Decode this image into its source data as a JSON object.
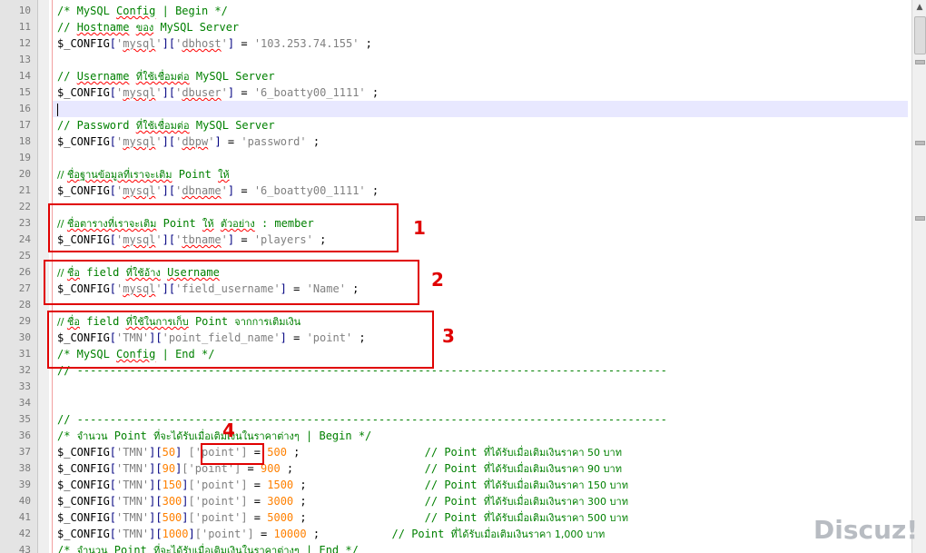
{
  "editor": {
    "lines": [
      {
        "n": "10",
        "parts": [
          [
            "cmt",
            "/* MySQL "
          ],
          [
            "cmt squig",
            "Config"
          ],
          [
            "cmt",
            " | Begin */"
          ]
        ]
      },
      {
        "n": "11",
        "parts": [
          [
            "cmt",
            "// "
          ],
          [
            "cmt squig",
            "Hostname"
          ],
          [
            "cmt",
            " "
          ],
          [
            "cmt thai squig",
            "ของ"
          ],
          [
            "cmt",
            " MySQL Server"
          ]
        ]
      },
      {
        "n": "12",
        "parts": [
          [
            "",
            "$_CONFIG"
          ],
          [
            "op",
            "["
          ],
          [
            "str",
            "'"
          ],
          [
            "str squig",
            "mysql"
          ],
          [
            "str",
            "'"
          ],
          [
            "op",
            "]["
          ],
          [
            "str",
            "'"
          ],
          [
            "str squig",
            "dbhost"
          ],
          [
            "str",
            "'"
          ],
          [
            "op",
            "]"
          ],
          [
            "",
            " = "
          ],
          [
            "str",
            "'103.253.74.155'"
          ],
          [
            "",
            " ;"
          ]
        ]
      },
      {
        "n": "13",
        "parts": []
      },
      {
        "n": "14",
        "parts": [
          [
            "cmt",
            "// "
          ],
          [
            "cmt squig",
            "Username"
          ],
          [
            "cmt",
            " "
          ],
          [
            "cmt thai squig",
            "ที่ใช้เชื่อมต่อ"
          ],
          [
            "cmt",
            " MySQL Server"
          ]
        ]
      },
      {
        "n": "15",
        "parts": [
          [
            "",
            "$_CONFIG"
          ],
          [
            "op",
            "["
          ],
          [
            "str",
            "'"
          ],
          [
            "str squig",
            "mysql"
          ],
          [
            "str",
            "'"
          ],
          [
            "op",
            "]["
          ],
          [
            "str",
            "'"
          ],
          [
            "str squig",
            "dbuser"
          ],
          [
            "str",
            "'"
          ],
          [
            "op",
            "]"
          ],
          [
            "",
            " = "
          ],
          [
            "str",
            "'6_boatty00_1111'"
          ],
          [
            "",
            " ;"
          ]
        ]
      },
      {
        "n": "16",
        "parts": [
          [
            "cursor",
            ""
          ]
        ],
        "current": true
      },
      {
        "n": "17",
        "parts": [
          [
            "cmt",
            "// Password "
          ],
          [
            "cmt thai squig",
            "ที่ใช้เชื่อมต่อ"
          ],
          [
            "cmt",
            " MySQL Server"
          ]
        ]
      },
      {
        "n": "18",
        "parts": [
          [
            "",
            "$_CONFIG"
          ],
          [
            "op",
            "["
          ],
          [
            "str",
            "'"
          ],
          [
            "str squig",
            "mysql"
          ],
          [
            "str",
            "'"
          ],
          [
            "op",
            "]["
          ],
          [
            "str",
            "'"
          ],
          [
            "str squig",
            "dbpw"
          ],
          [
            "str",
            "'"
          ],
          [
            "op",
            "]"
          ],
          [
            "",
            " = "
          ],
          [
            "str",
            "'password'"
          ],
          [
            "",
            " ;"
          ]
        ]
      },
      {
        "n": "19",
        "parts": []
      },
      {
        "n": "20",
        "parts": [
          [
            "cmt thai",
            "// "
          ],
          [
            "cmt thai squig",
            "ชื่อฐานข้อมูลที่เราจะเติม"
          ],
          [
            "cmt",
            " Point "
          ],
          [
            "cmt thai squig",
            "ให้"
          ]
        ]
      },
      {
        "n": "21",
        "parts": [
          [
            "",
            "$_CONFIG"
          ],
          [
            "op",
            "["
          ],
          [
            "str",
            "'"
          ],
          [
            "str squig",
            "mysql"
          ],
          [
            "str",
            "'"
          ],
          [
            "op",
            "]["
          ],
          [
            "str",
            "'"
          ],
          [
            "str squig",
            "dbname"
          ],
          [
            "str",
            "'"
          ],
          [
            "op",
            "]"
          ],
          [
            "",
            " = "
          ],
          [
            "str",
            "'6_boatty00_1111'"
          ],
          [
            "",
            " ;"
          ]
        ]
      },
      {
        "n": "22",
        "parts": []
      },
      {
        "n": "23",
        "parts": [
          [
            "cmt thai",
            "// "
          ],
          [
            "cmt thai squig",
            "ชื่อตารางที่เราจะเติม"
          ],
          [
            "cmt",
            " Point "
          ],
          [
            "cmt thai squig",
            "ให้"
          ],
          [
            "cmt",
            " "
          ],
          [
            "cmt thai squig",
            "ตัวอย่าง"
          ],
          [
            "cmt",
            " : member"
          ]
        ]
      },
      {
        "n": "24",
        "parts": [
          [
            "",
            "$_CONFIG"
          ],
          [
            "op",
            "["
          ],
          [
            "str",
            "'"
          ],
          [
            "str squig",
            "mysql"
          ],
          [
            "str",
            "'"
          ],
          [
            "op",
            "]["
          ],
          [
            "str",
            "'"
          ],
          [
            "str squig",
            "tbname"
          ],
          [
            "str",
            "'"
          ],
          [
            "op",
            "]"
          ],
          [
            "",
            " = "
          ],
          [
            "str",
            "'players'"
          ],
          [
            "",
            " ;"
          ]
        ]
      },
      {
        "n": "25",
        "parts": []
      },
      {
        "n": "26",
        "parts": [
          [
            "cmt thai",
            "// "
          ],
          [
            "cmt thai squig",
            "ชื่อ"
          ],
          [
            "cmt",
            " field "
          ],
          [
            "cmt thai squig",
            "ที่ใช้อ้าง"
          ],
          [
            "cmt",
            " "
          ],
          [
            "cmt squig",
            "Username"
          ]
        ]
      },
      {
        "n": "27",
        "parts": [
          [
            "",
            "$_CONFIG"
          ],
          [
            "op",
            "["
          ],
          [
            "str",
            "'"
          ],
          [
            "str squig",
            "mysql"
          ],
          [
            "str",
            "'"
          ],
          [
            "op",
            "]["
          ],
          [
            "str",
            "'field_username'"
          ],
          [
            "op",
            "]"
          ],
          [
            "",
            " = "
          ],
          [
            "str",
            "'Name'"
          ],
          [
            "",
            " ;"
          ]
        ]
      },
      {
        "n": "28",
        "parts": []
      },
      {
        "n": "29",
        "parts": [
          [
            "cmt thai",
            "// "
          ],
          [
            "cmt thai squig",
            "ชื่อ"
          ],
          [
            "cmt",
            " field "
          ],
          [
            "cmt thai squig",
            "ที่ใช้ในการเก็บ"
          ],
          [
            "cmt",
            " Point "
          ],
          [
            "cmt thai",
            "จากการเติมเงิน"
          ]
        ]
      },
      {
        "n": "30",
        "parts": [
          [
            "",
            "$_CONFIG"
          ],
          [
            "op",
            "["
          ],
          [
            "str",
            "'TMN'"
          ],
          [
            "op",
            "]["
          ],
          [
            "str",
            "'point_field_name'"
          ],
          [
            "op",
            "]"
          ],
          [
            "",
            " = "
          ],
          [
            "str",
            "'point'"
          ],
          [
            "",
            " ;"
          ]
        ]
      },
      {
        "n": "31",
        "parts": [
          [
            "cmt",
            "/* MySQL "
          ],
          [
            "cmt squig",
            "Config"
          ],
          [
            "cmt",
            " | End */"
          ]
        ]
      },
      {
        "n": "32",
        "parts": [
          [
            "cmt",
            "// ------------------------------------------------------------------------------------------"
          ]
        ]
      },
      {
        "n": "33",
        "parts": []
      },
      {
        "n": "34",
        "parts": []
      },
      {
        "n": "35",
        "parts": [
          [
            "cmt",
            "// ------------------------------------------------------------------------------------------"
          ]
        ]
      },
      {
        "n": "36",
        "parts": [
          [
            "cmt",
            "/* "
          ],
          [
            "cmt thai",
            "จำนวน"
          ],
          [
            "cmt",
            " Point "
          ],
          [
            "cmt thai",
            "ที่จะได้รับเมื่อเติมเงินในราคาต่างๆ"
          ],
          [
            "cmt",
            " | Begin */"
          ]
        ]
      },
      {
        "n": "37",
        "parts": [
          [
            "",
            "$_CONFIG"
          ],
          [
            "op",
            "["
          ],
          [
            "str",
            "'TMN'"
          ],
          [
            "op",
            "]["
          ],
          [
            "num",
            "50"
          ],
          [
            "op",
            "]"
          ],
          [
            "",
            " "
          ],
          [
            "str",
            "['point']"
          ],
          [
            "",
            " = "
          ],
          [
            "num",
            "500"
          ],
          [
            "",
            " ;                   "
          ],
          [
            "cmt",
            "// Point "
          ],
          [
            "cmt thai",
            "ที่ได้รับเมื่อเติมเงินราคา 50 บาท"
          ]
        ]
      },
      {
        "n": "38",
        "parts": [
          [
            "",
            "$_CONFIG"
          ],
          [
            "op",
            "["
          ],
          [
            "str",
            "'TMN'"
          ],
          [
            "op",
            "]["
          ],
          [
            "num",
            "90"
          ],
          [
            "op",
            "]"
          ],
          [
            "str",
            "['point']"
          ],
          [
            "",
            " = "
          ],
          [
            "num",
            "900"
          ],
          [
            "",
            " ;                    "
          ],
          [
            "cmt",
            "// Point "
          ],
          [
            "cmt thai",
            "ที่ได้รับเมื่อเติมเงินราคา 90 บาท"
          ]
        ]
      },
      {
        "n": "39",
        "parts": [
          [
            "",
            "$_CONFIG"
          ],
          [
            "op",
            "["
          ],
          [
            "str",
            "'TMN'"
          ],
          [
            "op",
            "]["
          ],
          [
            "num",
            "150"
          ],
          [
            "op",
            "]"
          ],
          [
            "str",
            "['point']"
          ],
          [
            "",
            " = "
          ],
          [
            "num",
            "1500"
          ],
          [
            "",
            " ;                  "
          ],
          [
            "cmt",
            "// Point "
          ],
          [
            "cmt thai",
            "ที่ได้รับเมื่อเติมเงินราคา 150 บาท"
          ]
        ]
      },
      {
        "n": "40",
        "parts": [
          [
            "",
            "$_CONFIG"
          ],
          [
            "op",
            "["
          ],
          [
            "str",
            "'TMN'"
          ],
          [
            "op",
            "]["
          ],
          [
            "num",
            "300"
          ],
          [
            "op",
            "]"
          ],
          [
            "str",
            "['point']"
          ],
          [
            "",
            " = "
          ],
          [
            "num",
            "3000"
          ],
          [
            "",
            " ;                  "
          ],
          [
            "cmt",
            "// Point "
          ],
          [
            "cmt thai",
            "ที่ได้รับเมื่อเติมเงินราคา 300 บาท"
          ]
        ]
      },
      {
        "n": "41",
        "parts": [
          [
            "",
            "$_CONFIG"
          ],
          [
            "op",
            "["
          ],
          [
            "str",
            "'TMN'"
          ],
          [
            "op",
            "]["
          ],
          [
            "num",
            "500"
          ],
          [
            "op",
            "]"
          ],
          [
            "str",
            "['point']"
          ],
          [
            "",
            " = "
          ],
          [
            "num",
            "5000"
          ],
          [
            "",
            " ;                  "
          ],
          [
            "cmt",
            "// Point "
          ],
          [
            "cmt thai",
            "ที่ได้รับเมื่อเติมเงินราคา 500 บาท"
          ]
        ]
      },
      {
        "n": "42",
        "parts": [
          [
            "",
            "$_CONFIG"
          ],
          [
            "op",
            "["
          ],
          [
            "str",
            "'TMN'"
          ],
          [
            "op",
            "]["
          ],
          [
            "num",
            "1000"
          ],
          [
            "op",
            "]"
          ],
          [
            "str",
            "['point']"
          ],
          [
            "",
            " = "
          ],
          [
            "num",
            "10000"
          ],
          [
            "",
            " ;           "
          ],
          [
            "cmt",
            "// Point "
          ],
          [
            "cmt thai",
            "ที่ได้รับเมื่อเติมเงินราคา 1,000 บาท"
          ]
        ]
      },
      {
        "n": "43",
        "parts": [
          [
            "cmt",
            "/* "
          ],
          [
            "cmt thai",
            "จำนวน"
          ],
          [
            "cmt",
            " Point "
          ],
          [
            "cmt thai",
            "ที่จะได้รับเมื่อเติมเงินในราคาต่างๆ"
          ],
          [
            "cmt",
            " | End */"
          ]
        ]
      }
    ]
  },
  "annotations": [
    {
      "label": "1"
    },
    {
      "label": "2"
    },
    {
      "label": "3"
    },
    {
      "label": "4"
    }
  ],
  "scrollbar": {
    "up_icon": "▲"
  },
  "watermark": "Discuz!"
}
